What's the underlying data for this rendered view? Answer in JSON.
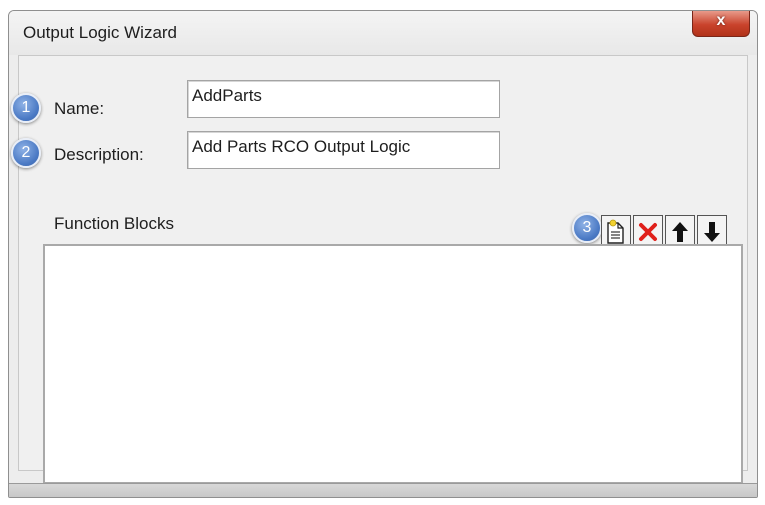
{
  "window": {
    "title": "Output Logic Wizard",
    "close_glyph": "x"
  },
  "form": {
    "name": {
      "badge": "1",
      "label": "Name:",
      "value": "AddParts"
    },
    "description": {
      "badge": "2",
      "label": "Description:",
      "value": "Add Parts RCO Output Logic"
    }
  },
  "function_blocks": {
    "label": "Function Blocks",
    "toolbar_badge": "3",
    "toolbar": [
      {
        "icon": "new-page-icon"
      },
      {
        "icon": "delete-x-icon"
      },
      {
        "icon": "arrow-up-icon"
      },
      {
        "icon": "arrow-down-icon"
      }
    ],
    "items": []
  },
  "colors": {
    "badge_blue": "#4a79c4",
    "close_red": "#c9432c",
    "delete_red": "#e0201b"
  }
}
